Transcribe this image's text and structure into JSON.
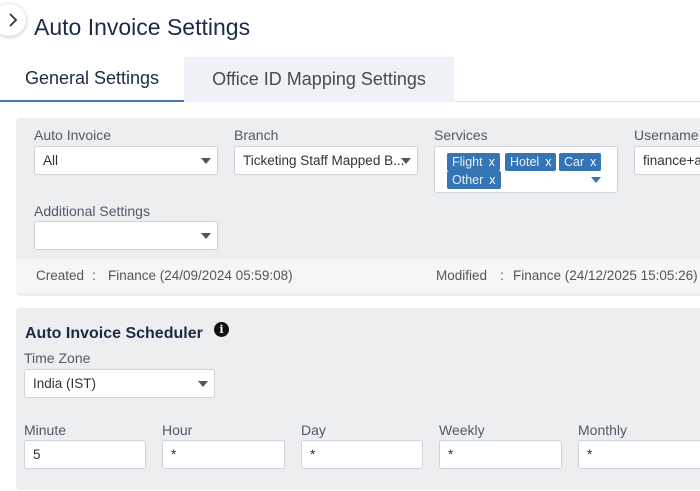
{
  "page": {
    "title": "Auto Invoice Settings"
  },
  "tabs": [
    {
      "label": "General Settings",
      "active": true
    },
    {
      "label": "Office ID Mapping Settings",
      "active": false
    }
  ],
  "general": {
    "auto_invoice": {
      "label": "Auto Invoice",
      "value": "All"
    },
    "branch": {
      "label": "Branch",
      "value": "Ticketing Staff Mapped B..."
    },
    "services": {
      "label": "Services",
      "tags": [
        "Flight",
        "Hotel",
        "Car",
        "Other"
      ],
      "remove_glyph": "x"
    },
    "username": {
      "label": "Username",
      "value": "finance+a"
    },
    "additional": {
      "label": "Additional Settings",
      "value": ""
    },
    "created": {
      "label": "Created",
      "sep": ":",
      "value": "Finance (24/09/2024 05:59:08)"
    },
    "modified": {
      "label": "Modified",
      "sep": ":",
      "value": "Finance (24/12/2025 15:05:26)"
    }
  },
  "scheduler": {
    "title": "Auto Invoice Scheduler",
    "info_glyph": "i",
    "timezone": {
      "label": "Time Zone",
      "value": "India (IST)"
    },
    "minute": {
      "label": "Minute",
      "value": "5"
    },
    "hour": {
      "label": "Hour",
      "value": "*"
    },
    "day": {
      "label": "Day",
      "value": "*"
    },
    "weekly": {
      "label": "Weekly",
      "value": "*"
    },
    "monthly": {
      "label": "Monthly",
      "value": "*"
    }
  },
  "colors": {
    "accent": "#3574b5",
    "title": "#1c2b45",
    "panel": "#eceef0"
  }
}
